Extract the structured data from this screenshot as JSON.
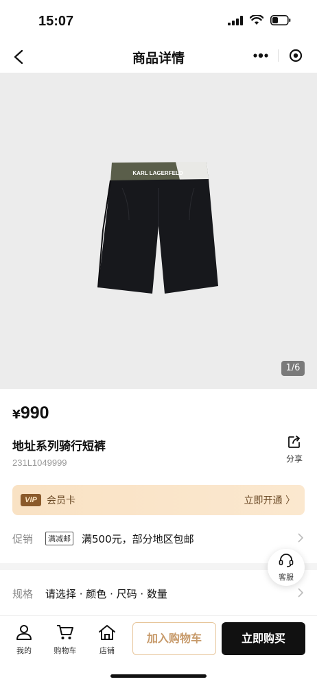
{
  "status_bar": {
    "time": "15:07"
  },
  "nav": {
    "title": "商品详情"
  },
  "gallery": {
    "page_indicator": "1/6",
    "product_brand_text": "KARL LAGERFELD"
  },
  "product": {
    "price_currency": "¥",
    "price_value": "990",
    "title": "地址系列骑行短裤",
    "sku": "231L1049999",
    "share_label": "分享"
  },
  "vip": {
    "badge": "VIP",
    "label": "会员卡",
    "action": "立即开通 〉"
  },
  "promo": {
    "label": "促销",
    "tag": "满减邮",
    "text": "满500元，部分地区包邮"
  },
  "spec": {
    "label": "规格",
    "text": "请选择 · 颜色 · 尺码 · 数量"
  },
  "customer_service": {
    "label": "客服"
  },
  "bottom_bar": {
    "tabs": [
      {
        "label": "我的",
        "icon": "user-icon"
      },
      {
        "label": "购物车",
        "icon": "cart-icon"
      },
      {
        "label": "店铺",
        "icon": "store-icon"
      }
    ],
    "add_to_cart": "加入购物车",
    "buy_now": "立即购买"
  },
  "colors": {
    "accent_gold": "#c79a6a",
    "vip_bg": "#f9e2c4",
    "buy_bg": "#111111"
  }
}
